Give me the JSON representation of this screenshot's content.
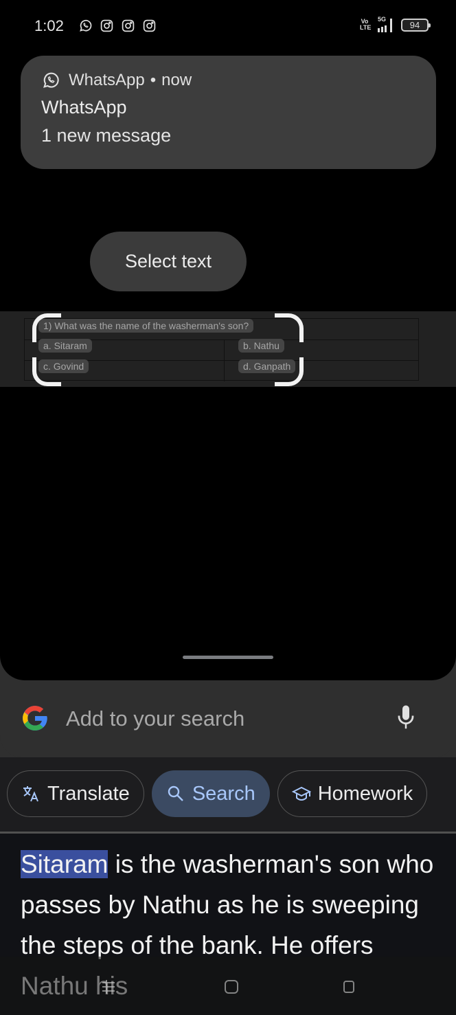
{
  "status_bar": {
    "time": "1:02",
    "notification_icons": [
      "whatsapp-icon",
      "instagram-icon",
      "instagram-icon",
      "instagram-icon"
    ],
    "volte_label": "Vo LTE",
    "network_label": "5G",
    "battery_percent": "94"
  },
  "notification": {
    "app_icon": "whatsapp-icon",
    "app_name": "WhatsApp",
    "separator": "•",
    "time": "now",
    "title": "WhatsApp",
    "body": "1 new message"
  },
  "select_text_button": {
    "label": "Select text"
  },
  "captured_content": {
    "question": "1)  What was the name of the washerman's son?",
    "options": [
      {
        "label": "a.  Sitaram"
      },
      {
        "label": "b.  Nathu"
      },
      {
        "label": "c.  Govind"
      },
      {
        "label": "d.  Ganpath"
      }
    ]
  },
  "search": {
    "logo": "google-g-logo",
    "placeholder": "Add to your search",
    "mic_icon": "mic-icon"
  },
  "chips": [
    {
      "label": "Translate",
      "icon": "translate-icon",
      "active": false
    },
    {
      "label": "Search",
      "icon": "search-icon",
      "active": true
    },
    {
      "label": "Homework",
      "icon": "graduation-cap-icon",
      "active": false
    }
  ],
  "result": {
    "highlighted": "Sitaram",
    "text": " is the washerman's son who passes by Nathu as he is sweeping the steps of the bank. He offers Nathu his"
  },
  "colors": {
    "accent_blue": "#a8c7fa",
    "active_chip_bg": "#3b4a62",
    "selection_highlight": "#3a4f9e",
    "notification_bg": "#3d3d3d"
  },
  "navigation_bar": [
    "recents-icon",
    "home-icon",
    "back-icon"
  ]
}
